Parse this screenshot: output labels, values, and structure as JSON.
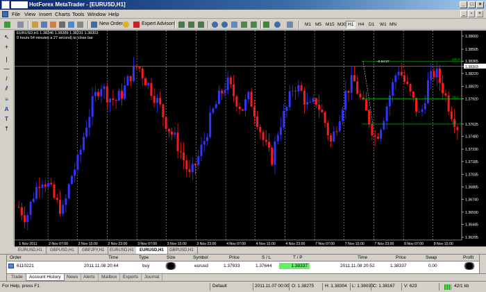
{
  "window": {
    "title": "HotForex MetaTrader - [EURUSD,H1]",
    "controls": [
      "_",
      "□",
      "×"
    ]
  },
  "menu": {
    "items": [
      "File",
      "View",
      "Insert",
      "Charts",
      "Tools",
      "Window",
      "Help"
    ]
  },
  "toolbar": {
    "new_order_label": "New Order",
    "expert_advisors_label": "Expert Advisors",
    "timeframes": [
      "M1",
      "M5",
      "M15",
      "M30",
      "H1",
      "H4",
      "D1",
      "W1",
      "MN"
    ],
    "active_timeframe": "H1"
  },
  "chart": {
    "header_line1": "EURUSD,H1  1.38346  1.38389  1.38231  1.38303",
    "header_line2": "0 hours 54 minutes a 27 second) to close bar",
    "price_labels": [
      "1.38660",
      "1.38505",
      "1.38365",
      "1.38303",
      "1.38220",
      "1.38070",
      "1.37920",
      "1.37625",
      "1.37480",
      "1.37330",
      "1.37185",
      "1.37035",
      "1.36885",
      "1.36740",
      "1.36590",
      "1.36445",
      "1.36295"
    ],
    "current_price_label": "1.38303",
    "time_labels": [
      "1 Nov 2011",
      "2 Nov 07:00",
      "2 Nov 15:00",
      "2 Nov 23:00",
      "3 Nov 07:00",
      "3 Nov 15:00",
      "3 Nov 23:00",
      "4 Nov 07:00",
      "4 Nov 15:00",
      "4 Nov 23:00",
      "7 Nov 07:00",
      "7 Nov 15:00",
      "7 Nov 23:00",
      "8 Nov 07:00",
      "8 Nov 15:00"
    ],
    "fib_labels": [
      "100.0",
      "38.2",
      "0.0"
    ],
    "trendline_label": "-0.54:27",
    "colors": {
      "bull": "#3333ff",
      "bear": "#ff1a1a",
      "background": "#000000",
      "grid": "#c8c8c8",
      "fib": "#00cc00"
    }
  },
  "chart_tabs": [
    "EURUSD,H1",
    "GBPUSD,H1",
    "GBPJPY,H1",
    "EURUSD,H1",
    "EURUSD,H1",
    "GBPUSD,H1"
  ],
  "active_chart_tab": 4,
  "terminal": {
    "headers": [
      "Order",
      "Time",
      "Type",
      "Size",
      "Symbol",
      "Price",
      "S / L",
      "T / P",
      "Time",
      "Price",
      "Swap",
      "Profit"
    ],
    "row": {
      "order": "6110221",
      "open_time": "2011.11.08 20:44",
      "type": "buy",
      "symbol": "eurusd",
      "price": "1.37933",
      "sl": "1.37644",
      "tp": "1.38337",
      "close_time": "2011.11.08 20:52",
      "close_price": "1.38337",
      "swap": "0.00"
    },
    "tp_highlight": "#66ee66"
  },
  "terminal_tabs": [
    "Trade",
    "Account History",
    "News",
    "Alerts",
    "Mailbox",
    "Experts",
    "Journal"
  ],
  "active_terminal_tab": "Account History",
  "status": {
    "help": "For Help, press F1",
    "profile": "Default",
    "datetime": "2011.11.07 00:00",
    "open": "O: 1.38275",
    "high": "H: 1.38304",
    "low": "L: 1.38030",
    "close": "C: 1.38167",
    "volume": "V: 623",
    "traffic": "42/1 kb"
  }
}
